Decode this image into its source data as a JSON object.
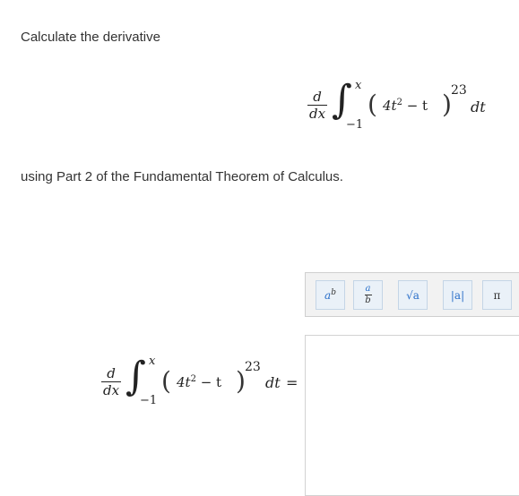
{
  "question": {
    "prompt": "Calculate the derivative",
    "instruction": "using Part 2 of the Fundamental Theorem of Calculus."
  },
  "expression": {
    "d_num": "d",
    "d_den": "dx",
    "integral_sign": "∫",
    "upper_limit": "x",
    "lower_limit": "−1",
    "open_paren": "(",
    "integrand_base": "4t",
    "integrand_power": "2",
    "integrand_rest": " − t",
    "close_paren": ")",
    "exponent": "23",
    "differential": "dt",
    "equals": "="
  },
  "toolbar": {
    "buttons": [
      {
        "name": "exponent-button",
        "label": "a",
        "sup": "b"
      },
      {
        "name": "fraction-button",
        "num": "a",
        "den": "b"
      },
      {
        "name": "sqrt-button",
        "label": "√a"
      },
      {
        "name": "abs-button",
        "label": "|a|"
      },
      {
        "name": "pi-button",
        "label": "π"
      }
    ]
  }
}
